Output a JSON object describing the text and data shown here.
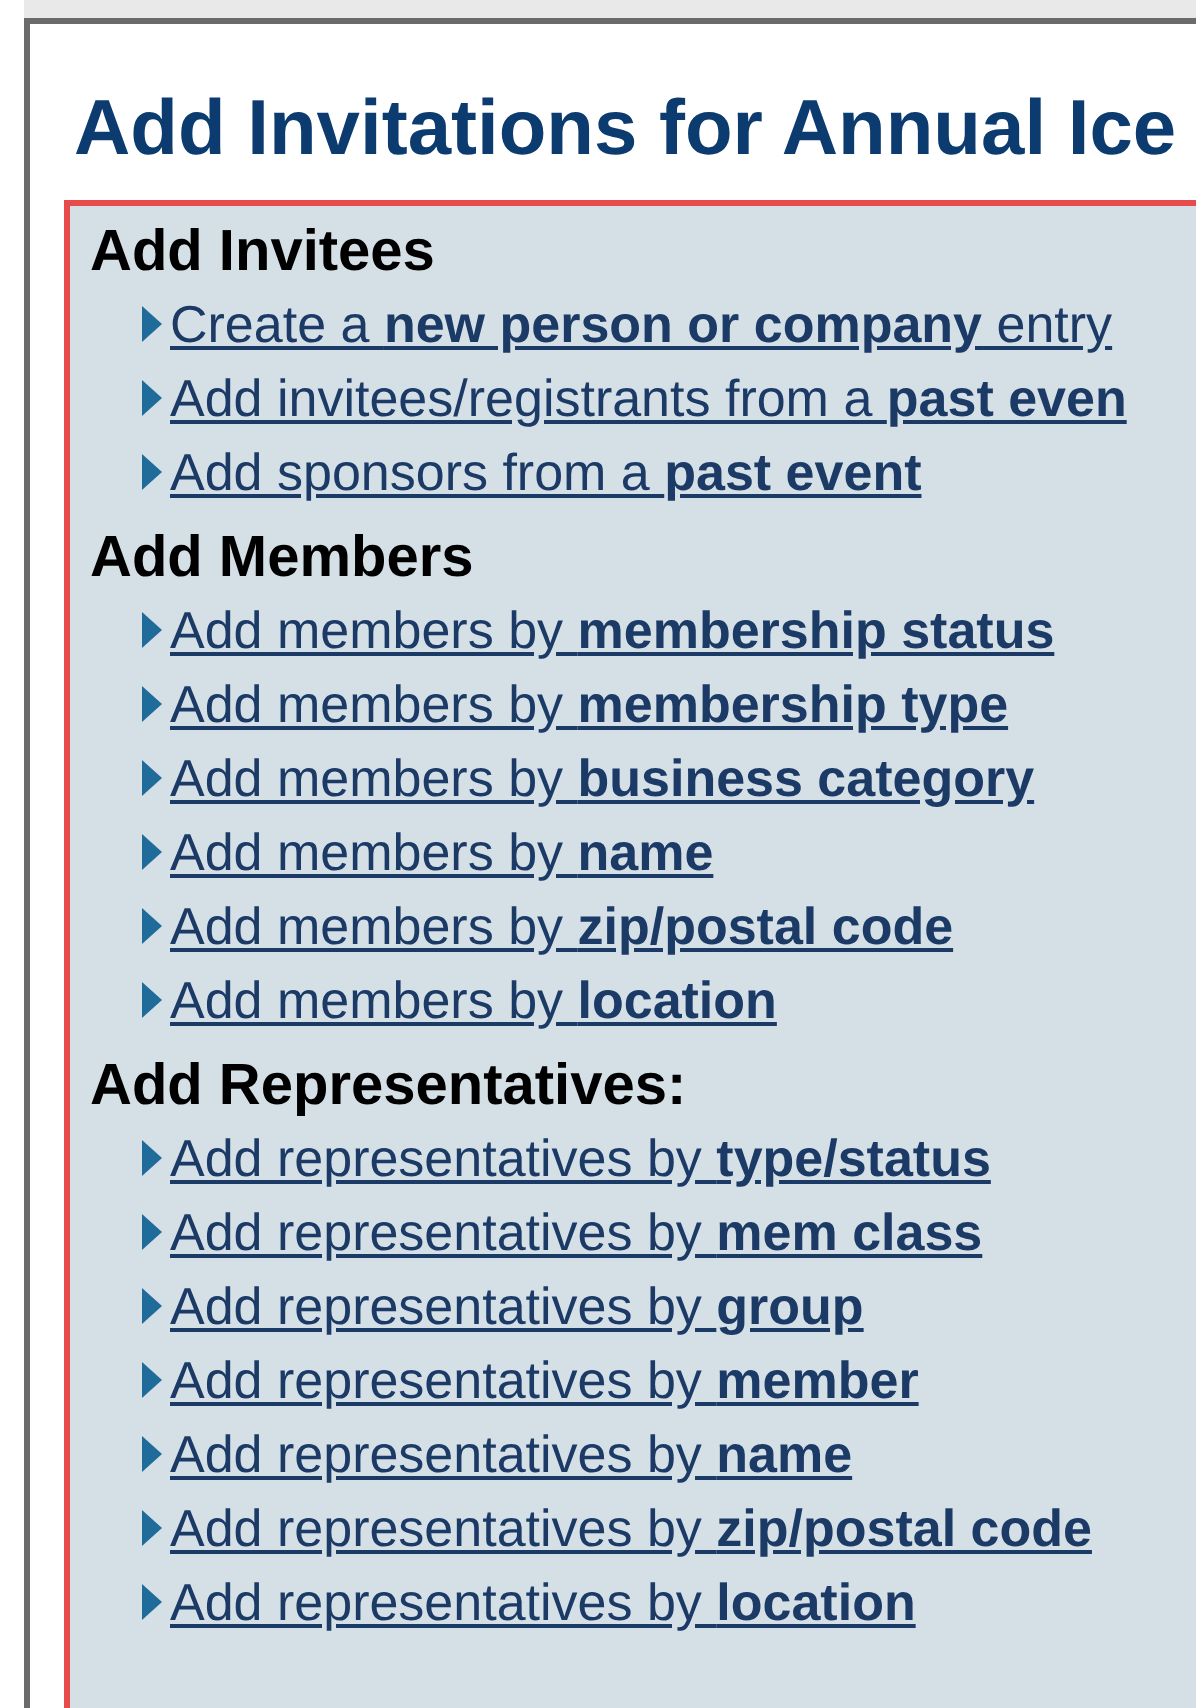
{
  "title": "Add Invitations for Annual Ice",
  "sections": [
    {
      "heading": "Add Invitees",
      "links": [
        "Create a **new person or company** entry",
        "Add invitees/registrants from a **past even**",
        "Add sponsors from a **past event**"
      ]
    },
    {
      "heading": "Add Members",
      "links": [
        "Add members by **membership status**",
        "Add members by **membership type**",
        "Add members by **business category**",
        "Add members by **name**",
        "Add members by **zip/postal code**",
        "Add members by **location**"
      ]
    },
    {
      "heading": "Add Representatives:",
      "links": [
        "Add representatives by **type/status**",
        "Add representatives by **mem class**",
        "Add representatives by **group**",
        "Add representatives by **member**",
        "Add representatives by **name**",
        "Add representatives by **zip/postal code**",
        "Add representatives by **location**"
      ]
    }
  ]
}
